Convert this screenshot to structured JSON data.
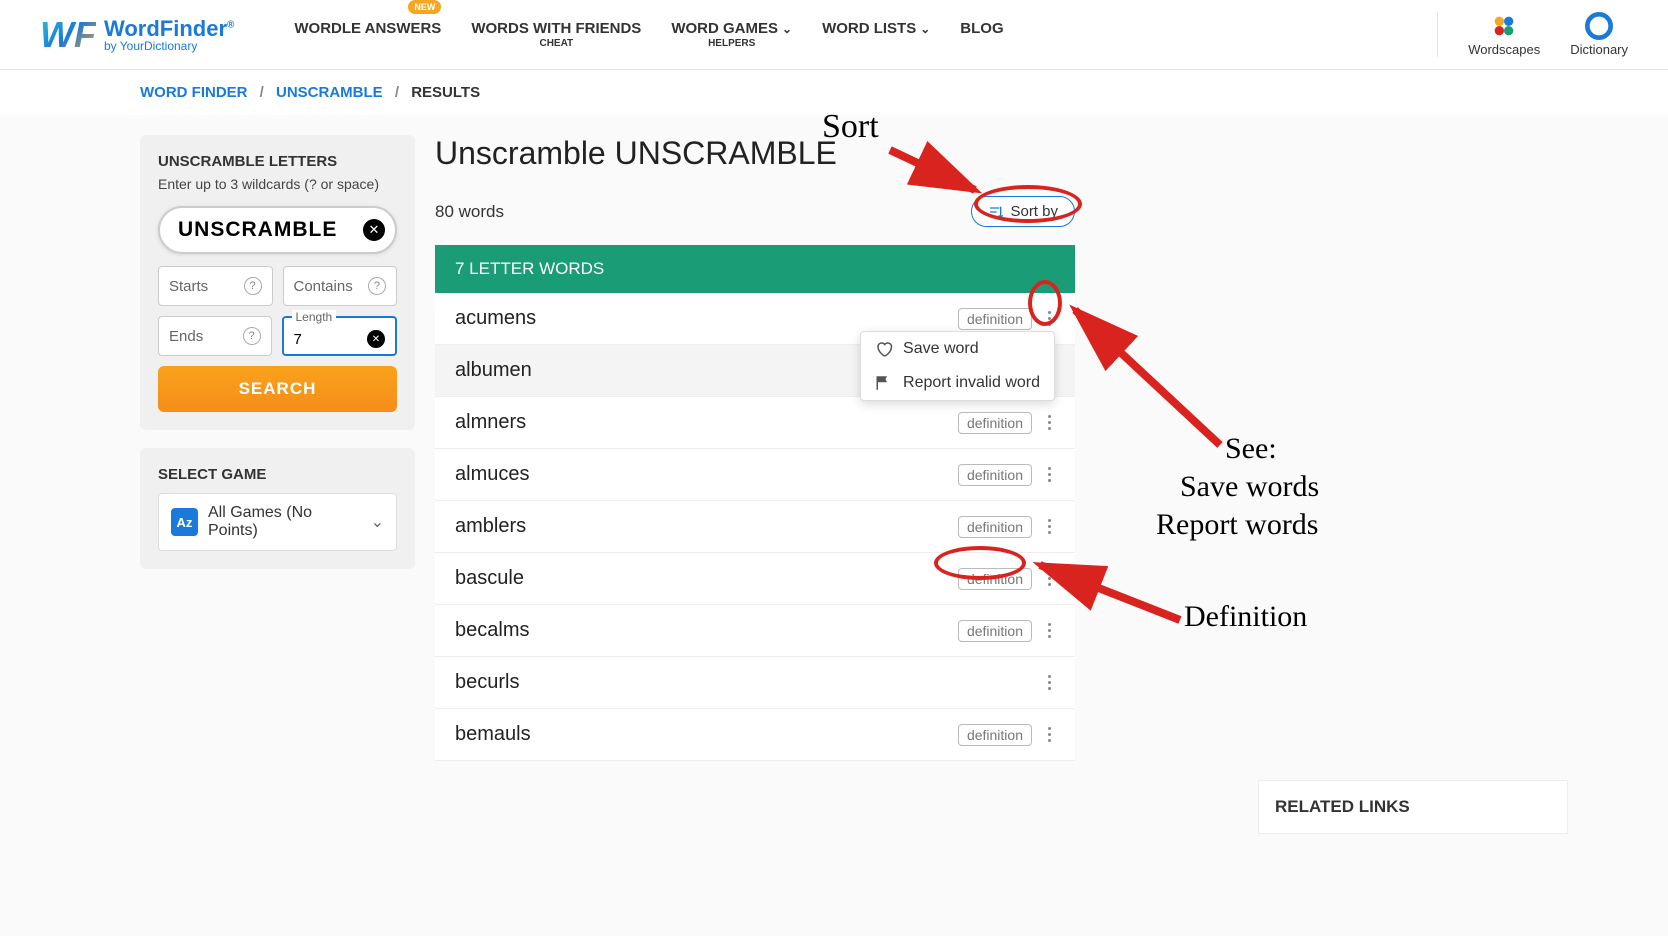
{
  "header": {
    "logo_prefix": "WF",
    "logo_title": "WordFinder",
    "logo_subtitle": "by YourDictionary",
    "nav": [
      {
        "label": "WORDLE ANSWERS",
        "badge": "NEW"
      },
      {
        "label": "WORDS WITH FRIENDS",
        "sub": "CHEAT"
      },
      {
        "label": "WORD GAMES",
        "sub": "HELPERS",
        "chevron": true
      },
      {
        "label": "WORD LISTS",
        "chevron": true
      },
      {
        "label": "BLOG"
      }
    ],
    "right": [
      {
        "label": "Wordscapes"
      },
      {
        "label": "Dictionary"
      }
    ]
  },
  "breadcrumb": {
    "items": [
      "WORD FINDER",
      "UNSCRAMBLE",
      "RESULTS"
    ]
  },
  "sidebar": {
    "unscramble_title": "UNSCRAMBLE LETTERS",
    "unscramble_hint": "Enter up to 3 wildcards (? or space)",
    "main_value": "UNSCRAMBLE",
    "filter_starts": "Starts",
    "filter_contains": "Contains",
    "filter_ends": "Ends",
    "filter_length_label": "Length",
    "filter_length_value": "7",
    "search_btn": "SEARCH",
    "select_game_title": "SELECT GAME",
    "game_icon": "Az",
    "game_value": "All Games (No Points)"
  },
  "main": {
    "title": "Unscramble UNSCRAMBLE",
    "count": "80 words",
    "sort_label": "Sort by",
    "group_header": "7 LETTER WORDS",
    "definition_label": "definition",
    "words": [
      "acumens",
      "albumen",
      "almners",
      "almuces",
      "amblers",
      "bascule",
      "becalms",
      "becurls",
      "bemauls"
    ],
    "has_def": {
      "acumens": true,
      "albumen": false,
      "almners": true,
      "almuces": true,
      "amblers": true,
      "bascule": true,
      "becalms": true,
      "becurls": false,
      "bemauls": true
    },
    "popup": {
      "save": "Save word",
      "report": "Report invalid word"
    }
  },
  "annotations": {
    "sort": "Sort",
    "see_line1": "See:",
    "see_line2": "Save words",
    "see_line3": "Report words",
    "definition": "Definition"
  },
  "related": {
    "title": "RELATED LINKS"
  }
}
